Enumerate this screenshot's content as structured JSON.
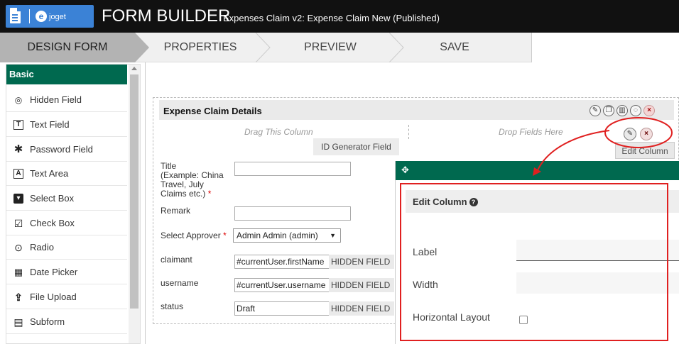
{
  "app": {
    "logo_text": "joget",
    "logo_letter": "e",
    "title": "FORM BUILDER",
    "subtitle": "Expenses Claim v2: Expense Claim New (Published)"
  },
  "steps": [
    {
      "label": "DESIGN FORM",
      "active": true
    },
    {
      "label": "PROPERTIES",
      "active": false
    },
    {
      "label": "PREVIEW",
      "active": false
    },
    {
      "label": "SAVE",
      "active": false
    }
  ],
  "palette": {
    "heading": "Basic",
    "items": [
      {
        "label": "Hidden Field",
        "icon": "eye-slash-icon",
        "glyph": "◎"
      },
      {
        "label": "Text Field",
        "icon": "text-field-icon",
        "glyph": "T"
      },
      {
        "label": "Password Field",
        "icon": "asterisk-icon",
        "glyph": "✱"
      },
      {
        "label": "Text Area",
        "icon": "text-area-icon",
        "glyph": "A"
      },
      {
        "label": "Select Box",
        "icon": "select-box-icon",
        "glyph": "▾"
      },
      {
        "label": "Check Box",
        "icon": "check-box-icon",
        "glyph": "☑"
      },
      {
        "label": "Radio",
        "icon": "radio-icon",
        "glyph": "⊙"
      },
      {
        "label": "Date Picker",
        "icon": "calendar-icon",
        "glyph": "▦"
      },
      {
        "label": "File Upload",
        "icon": "upload-icon",
        "glyph": "⇪"
      },
      {
        "label": "Subform",
        "icon": "subform-icon",
        "glyph": "▤"
      }
    ]
  },
  "section": {
    "title": "Expense Claim Details",
    "drag_column": "Drag This Column",
    "drop_fields": "Drop Fields Here",
    "id_generator": "ID Generator Field",
    "tooltip": "Edit Column"
  },
  "fields": {
    "title_lines": [
      "Title",
      "(Example: China",
      "Travel, July",
      "Claims etc.)"
    ],
    "required_mark": "*",
    "remark": "Remark",
    "approver_label": "Select Approver",
    "approver_value": "Admin Admin (admin)",
    "claimant_label": "claimant",
    "claimant_value": "#currentUser.firstName",
    "username_label": "username",
    "username_value": "#currentUser.username",
    "status_label": "status",
    "status_value": "Draft",
    "hidden_tag": "HIDDEN FIELD"
  },
  "panel": {
    "title": "Edit Column",
    "label_field": "Label",
    "width_field": "Width",
    "horizontal_layout": "Horizontal Layout",
    "label_value": "",
    "width_value": "",
    "horizontal_checked": false
  },
  "colors": {
    "accent": "#00694f",
    "annotation": "#e02020",
    "topbar": "#111111",
    "logo": "#3b82d6"
  }
}
